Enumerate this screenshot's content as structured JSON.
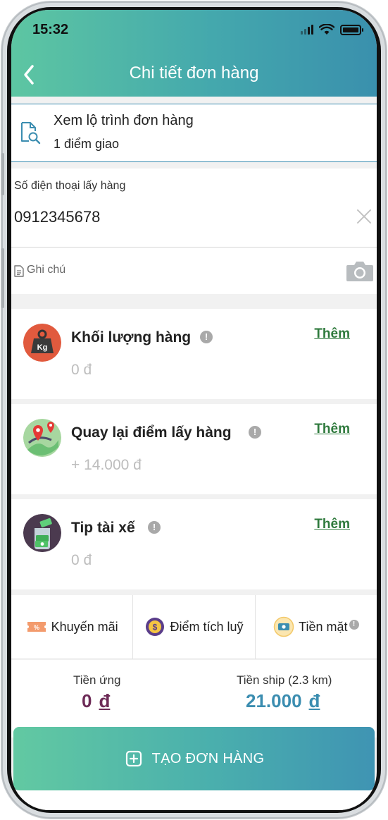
{
  "status_bar": {
    "time": "15:32"
  },
  "header": {
    "title": "Chi tiết đơn hàng"
  },
  "route": {
    "title": "Xem lộ trình đơn hàng",
    "subtitle": "1 điểm giao"
  },
  "pickup_phone": {
    "label": "Số điện thoại lấy hàng",
    "value": "0912345678"
  },
  "note": {
    "placeholder": "Ghi chú"
  },
  "services": [
    {
      "title": "Khối lượng hàng",
      "price": "0 đ",
      "action": "Thêm",
      "icon": "weight-kg-icon"
    },
    {
      "title": "Quay lại điểm lấy hàng",
      "price": "+ 14.000 đ",
      "action": "Thêm",
      "icon": "return-route-icon"
    },
    {
      "title": "Tip tài xế",
      "price": "0 đ",
      "action": "Thêm",
      "icon": "tip-money-icon"
    }
  ],
  "payment_tabs": [
    {
      "label": "Khuyến mãi",
      "icon": "coupon-icon"
    },
    {
      "label": "Điểm tích luỹ",
      "icon": "points-coin-icon"
    },
    {
      "label": "Tiền mặt",
      "icon": "cash-icon"
    }
  ],
  "totals": {
    "advance_label": "Tiền ứng",
    "advance_value": "0",
    "ship_label": "Tiền ship (2.3 km)",
    "ship_value": "21.000",
    "currency": "đ"
  },
  "create_button": {
    "label": "TẠO ĐƠN HÀNG"
  },
  "colors": {
    "accent": "#44a8ad",
    "link": "#2f7a3d",
    "advance": "#6d2b57",
    "ship": "#3b8db0"
  }
}
